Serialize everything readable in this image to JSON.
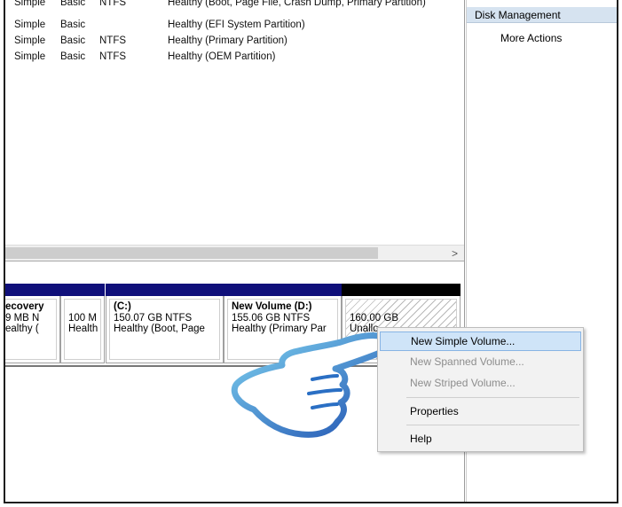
{
  "volume_list": {
    "rows": [
      {
        "layout": "Simple",
        "type": "Basic",
        "fs": "NTFS",
        "status": "Healthy (Boot, Page File, Crash Dump, Primary Partition)"
      },
      {
        "layout": "Simple",
        "type": "Basic",
        "fs": "",
        "status": "Healthy (EFI System Partition)"
      },
      {
        "layout": "Simple",
        "type": "Basic",
        "fs": "NTFS",
        "status": "Healthy (Primary Partition)"
      },
      {
        "layout": "Simple",
        "type": "Basic",
        "fs": "NTFS",
        "status": "Healthy (OEM Partition)"
      }
    ],
    "scroll_right_glyph": ">"
  },
  "disk": {
    "partitions": [
      {
        "title": "ecovery",
        "line1": "9 MB N",
        "line2": "ealthy ("
      },
      {
        "title": "",
        "line1": "100 M",
        "line2": "Health"
      },
      {
        "title": "(C:)",
        "line1": "150.07 GB NTFS",
        "line2": "Healthy (Boot, Page"
      },
      {
        "title": "New Volume  (D:)",
        "line1": "155.06 GB NTFS",
        "line2": "Healthy (Primary Par"
      },
      {
        "title": "",
        "line1": "160.00 GB",
        "line2": "Unallo"
      }
    ]
  },
  "actions": {
    "header": "Disk Management",
    "more_actions": "More Actions"
  },
  "context_menu": {
    "items": [
      {
        "label": "New Simple Volume...",
        "state": "highlighted"
      },
      {
        "label": "New Spanned Volume...",
        "state": "disabled"
      },
      {
        "label": "New Striped Volume...",
        "state": "disabled"
      },
      {
        "label": "Properties",
        "state": "enabled"
      },
      {
        "label": "Help",
        "state": "enabled"
      }
    ]
  },
  "icons": {
    "pointer": "pointing-hand-icon"
  },
  "colors": {
    "partition_bar": "#0f0f7a",
    "unallocated_bar": "#000000",
    "menu_highlight": "#cfe4f8",
    "actions_header": "#d6e3f0",
    "hand_outline": "#1e4fb0"
  }
}
